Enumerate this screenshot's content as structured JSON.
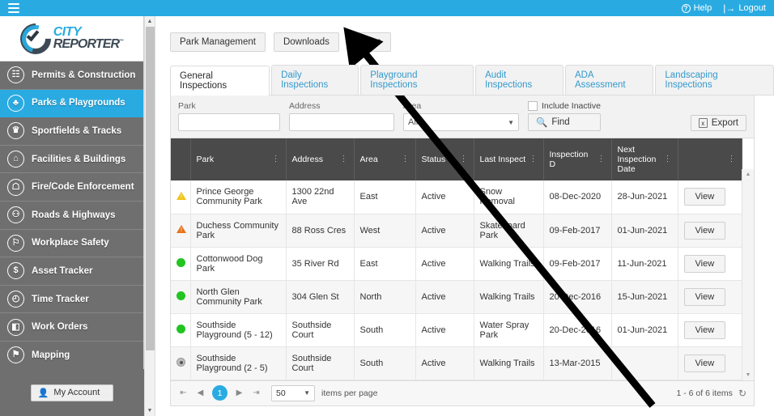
{
  "topbar": {
    "menu_icon": "hamburger-icon",
    "help_label": "Help",
    "logout_label": "Logout",
    "background": "#29abe2"
  },
  "sidebar": {
    "logo": {
      "city": "CITY",
      "reporter": "REPORTER",
      "tm": "™"
    },
    "items": [
      {
        "label": "Permits & Construction",
        "icon": "building-icon",
        "glyph": "Ἶ2",
        "active": false
      },
      {
        "label": "Parks & Playgrounds",
        "icon": "tree-icon",
        "glyph": "♣",
        "active": true
      },
      {
        "label": "Sportfields & Tracks",
        "icon": "trophy-icon",
        "glyph": "♛",
        "active": false
      },
      {
        "label": "Facilities & Buildings",
        "icon": "house-icon",
        "glyph": "⌂",
        "active": false
      },
      {
        "label": "Fire/Code Enforcement",
        "icon": "hydrant-icon",
        "glyph": "☖",
        "active": false
      },
      {
        "label": "Roads & Highways",
        "icon": "traffic-light-icon",
        "glyph": "⚇",
        "active": false
      },
      {
        "label": "Workplace Safety",
        "icon": "badge-icon",
        "glyph": "⚐",
        "active": false
      },
      {
        "label": "Asset Tracker",
        "icon": "dollar-hand-icon",
        "glyph": "$",
        "active": false
      },
      {
        "label": "Time Tracker",
        "icon": "clock-icon",
        "glyph": "◴",
        "active": false
      },
      {
        "label": "Work Orders",
        "icon": "clipboard-icon",
        "glyph": "◧",
        "active": false
      },
      {
        "label": "Mapping",
        "icon": "map-pin-icon",
        "glyph": "⚑",
        "active": false
      }
    ],
    "account_label": "My Account",
    "account_icon": "person-icon"
  },
  "toolbar": {
    "buttons": [
      {
        "label": "Park Management"
      },
      {
        "label": "Downloads"
      },
      {
        "label": "Setup"
      }
    ]
  },
  "tabs": [
    {
      "label": "General Inspections",
      "active": true
    },
    {
      "label": "Daily Inspections",
      "active": false
    },
    {
      "label": "Playground Inspections",
      "active": false
    },
    {
      "label": "Audit Inspections",
      "active": false
    },
    {
      "label": "ADA Assessment",
      "active": false
    },
    {
      "label": "Landscaping Inspections",
      "active": false
    }
  ],
  "filters": {
    "park_label": "Park",
    "park_value": "",
    "park_placeholder": "",
    "address_label": "Address",
    "address_value": "",
    "address_placeholder": "",
    "area_label": "Area",
    "area_value": "All",
    "include_inactive_label": "Include Inactive",
    "include_inactive_checked": false,
    "find_label": "Find",
    "find_icon": "search-icon",
    "export_label": "Export",
    "export_icon": "excel-icon"
  },
  "grid": {
    "columns": [
      {
        "key": "status_icon",
        "label": ""
      },
      {
        "key": "park",
        "label": "Park"
      },
      {
        "key": "address",
        "label": "Address"
      },
      {
        "key": "area",
        "label": "Area"
      },
      {
        "key": "status",
        "label": "Status"
      },
      {
        "key": "last_inspect",
        "label": "Last Inspect"
      },
      {
        "key": "inspection_d",
        "label": "Inspection D"
      },
      {
        "key": "next_inspection_date",
        "label": "Next Inspection Date"
      },
      {
        "key": "action",
        "label": ""
      }
    ],
    "rows": [
      {
        "status_icon": "warning-triangle-yellow",
        "park": "Prince George Community Park",
        "address": "1300 22nd Ave",
        "area": "East",
        "status": "Active",
        "last_inspect": "Snow Removal",
        "inspection_d": "08-Dec-2020",
        "next_inspection_date": "28-Jun-2021",
        "action": "View"
      },
      {
        "status_icon": "warning-triangle-orange",
        "park": "Duchess Community Park",
        "address": "88 Ross Cres",
        "area": "West",
        "status": "Active",
        "last_inspect": "Skateboard Park",
        "inspection_d": "09-Feb-2017",
        "next_inspection_date": "01-Jun-2021",
        "action": "View"
      },
      {
        "status_icon": "status-dot-green",
        "park": "Cottonwood Dog Park",
        "address": "35 River Rd",
        "area": "East",
        "status": "Active",
        "last_inspect": "Walking Trails",
        "inspection_d": "09-Feb-2017",
        "next_inspection_date": "11-Jun-2021",
        "action": "View"
      },
      {
        "status_icon": "status-dot-green",
        "park": "North Glen Community Park",
        "address": "304 Glen St",
        "area": "North",
        "status": "Active",
        "last_inspect": "Walking Trails",
        "inspection_d": "20-Dec-2016",
        "next_inspection_date": "15-Jun-2021",
        "action": "View"
      },
      {
        "status_icon": "status-dot-green",
        "park": "Southside Playground (5 - 12)",
        "address": "Southside Court",
        "area": "South",
        "status": "Active",
        "last_inspect": "Water Spray Park",
        "inspection_d": "20-Dec-2016",
        "next_inspection_date": "01-Jun-2021",
        "action": "View"
      },
      {
        "status_icon": "status-dot-gray",
        "park": "Southside Playground (2 - 5)",
        "address": "Southside Court",
        "area": "South",
        "status": "Active",
        "last_inspect": "Walking Trails",
        "inspection_d": "13-Mar-2015",
        "next_inspection_date": "",
        "action": "View"
      }
    ]
  },
  "pager": {
    "first_icon": "first-page-icon",
    "prev_icon": "prev-page-icon",
    "current_page": "1",
    "next_icon": "next-page-icon",
    "last_icon": "last-page-icon",
    "page_size": "50",
    "items_per_page_label": "items per page",
    "range_label": "1 - 6 of 6 items",
    "refresh_icon": "refresh-icon"
  },
  "annotation": {
    "type": "arrow",
    "color": "#000000",
    "points_to": "Setup"
  },
  "colors": {
    "accent": "#29abe2",
    "sidebar": "#6f6f6f",
    "grid_header": "#4a4a4a",
    "warn_yellow": "#f0c419",
    "warn_orange": "#e8721c",
    "ok_green": "#21c421"
  }
}
